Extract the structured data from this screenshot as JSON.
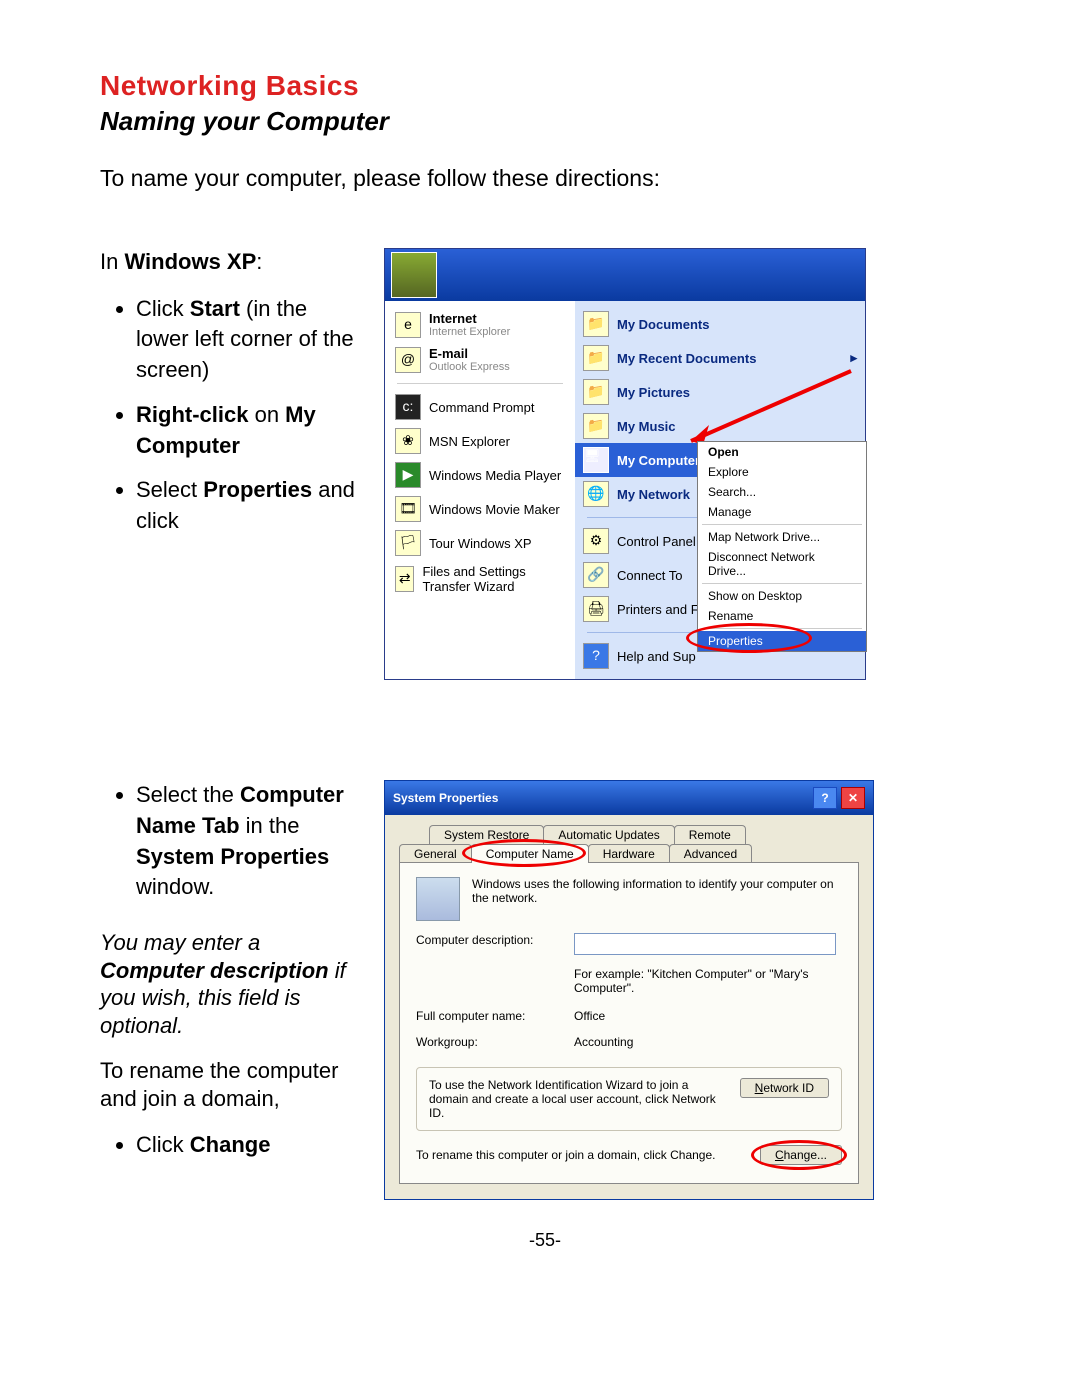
{
  "doc": {
    "heading": "Networking Basics",
    "subheading": "Naming your Computer",
    "intro": "To name your computer, please follow these directions:",
    "pagenum": "-55-"
  },
  "sectionA": {
    "lead_pre": "In ",
    "lead_bold": "Windows XP",
    "lead_post": ":",
    "b1_pre": "Click ",
    "b1_bold": "Start",
    "b1_post": " (in the lower left corner of the screen)",
    "b2_bold": "Right-click",
    "b2_mid": " on ",
    "b2_bold2": "My Computer",
    "b3_pre": "Select ",
    "b3_bold": "Properties",
    "b3_post": " and click"
  },
  "startmenu": {
    "left": {
      "internet": "Internet",
      "internet_sub": "Internet Explorer",
      "email": "E-mail",
      "email_sub": "Outlook Express",
      "cmd": "Command Prompt",
      "msn": "MSN Explorer",
      "wmp": "Windows Media Player",
      "wmm": "Windows Movie Maker",
      "tour": "Tour Windows XP",
      "fast": "Files and Settings Transfer Wizard"
    },
    "right": {
      "mydocs": "My Documents",
      "recent": "My Recent Documents",
      "pics": "My Pictures",
      "music": "My Music",
      "mycomp": "My Computer",
      "mynet": "My Network",
      "cpanel": "Control Panel",
      "connect": "Connect To",
      "printers": "Printers and F",
      "help": "Help and Sup"
    },
    "context": {
      "open": "Open",
      "explore": "Explore",
      "search": "Search...",
      "manage": "Manage",
      "mapdrive": "Map Network Drive...",
      "discon": "Disconnect Network Drive...",
      "desktop": "Show on Desktop",
      "rename": "Rename",
      "props": "Properties"
    }
  },
  "sectionB": {
    "b1_pre": "Select the ",
    "b1_bold1": "Computer Name Tab",
    "b1_mid": " in the ",
    "b1_bold2": "System Properties",
    "b1_post": " window.",
    "italic_pre": "You may enter a ",
    "italic_bold": "Computer description",
    "italic_post": " if you wish, this field is optional.",
    "rename": "To rename the computer and join a domain,",
    "b2_pre": "Click ",
    "b2_bold": "Change"
  },
  "sysprops": {
    "title": "System Properties",
    "tabs_row1": [
      "System Restore",
      "Automatic Updates",
      "Remote"
    ],
    "tabs_row2": [
      "General",
      "Computer Name",
      "Hardware",
      "Advanced"
    ],
    "blurb": "Windows uses the following information to identify your computer on the network.",
    "desc_label": "Computer description:",
    "example": "For example: \"Kitchen Computer\" or \"Mary's Computer\".",
    "fullname_label": "Full computer name:",
    "fullname_value": "Office",
    "workgroup_label": "Workgroup:",
    "workgroup_value": "Accounting",
    "wizard_text": "To use the Network Identification Wizard to join a domain and create a local user account, click Network ID.",
    "networkid_btn": "Network ID",
    "rename_text": "To rename this computer or join a domain, click Change.",
    "change_btn": "Change..."
  }
}
